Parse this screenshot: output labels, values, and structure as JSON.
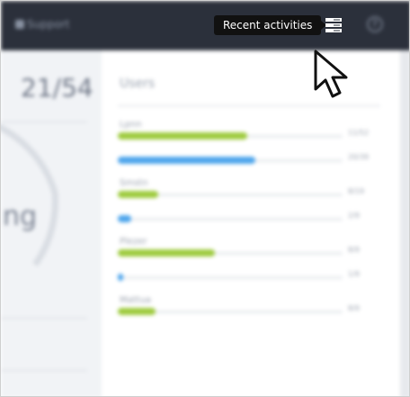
{
  "header": {
    "brand_label": "Support",
    "help_icon": "help-icon",
    "activities_icon": "list-icon"
  },
  "tooltip": {
    "text": "Recent activities"
  },
  "left_panel": {
    "metric": "21/54",
    "gauge_text": "ng"
  },
  "users_section": {
    "title": "Users",
    "rows": [
      {
        "label": "Lpnn",
        "value": "11/52",
        "fill": 0.48,
        "color": "green"
      },
      {
        "label": "",
        "value": "20/39",
        "fill": 0.51,
        "color": "blue"
      },
      {
        "label": "Smstn",
        "value": "8/19",
        "fill": 0.15,
        "color": "green"
      },
      {
        "label": "",
        "value": "2/9",
        "fill": 0.05,
        "color": "blue"
      },
      {
        "label": "Plezer",
        "value": "8/9",
        "fill": 0.36,
        "color": "green"
      },
      {
        "label": "",
        "value": "1/9",
        "fill": 0.02,
        "color": "blue"
      },
      {
        "label": "Mattua",
        "value": "8/9",
        "fill": 0.14,
        "color": "green"
      }
    ]
  },
  "colors": {
    "topbar": "#2b303b",
    "green": "#9ecb3e",
    "blue": "#4da5ec",
    "tooltip_bg": "#111111"
  }
}
